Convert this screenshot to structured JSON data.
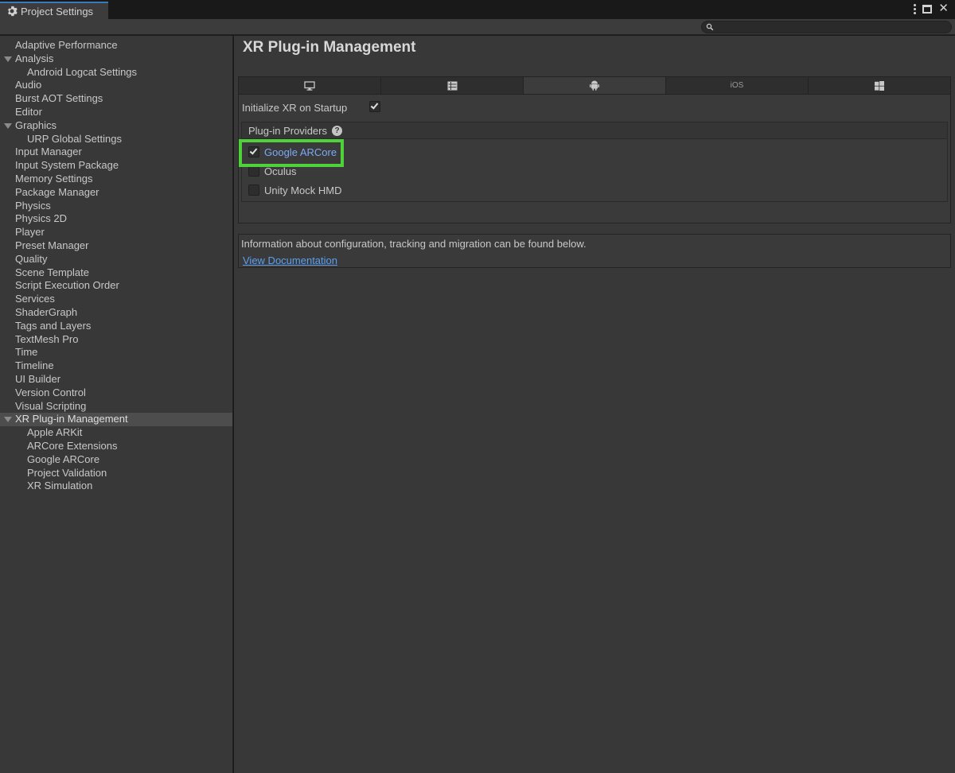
{
  "window": {
    "tab_title": "Project Settings"
  },
  "search": {
    "placeholder": ""
  },
  "sidebar": {
    "items": [
      {
        "label": "Adaptive Performance",
        "level": 0
      },
      {
        "label": "Analysis",
        "level": 0,
        "expanded": true
      },
      {
        "label": "Android Logcat Settings",
        "level": 1
      },
      {
        "label": "Audio",
        "level": 0
      },
      {
        "label": "Burst AOT Settings",
        "level": 0
      },
      {
        "label": "Editor",
        "level": 0
      },
      {
        "label": "Graphics",
        "level": 0,
        "expanded": true
      },
      {
        "label": "URP Global Settings",
        "level": 1
      },
      {
        "label": "Input Manager",
        "level": 0
      },
      {
        "label": "Input System Package",
        "level": 0
      },
      {
        "label": "Memory Settings",
        "level": 0
      },
      {
        "label": "Package Manager",
        "level": 0
      },
      {
        "label": "Physics",
        "level": 0
      },
      {
        "label": "Physics 2D",
        "level": 0
      },
      {
        "label": "Player",
        "level": 0
      },
      {
        "label": "Preset Manager",
        "level": 0
      },
      {
        "label": "Quality",
        "level": 0
      },
      {
        "label": "Scene Template",
        "level": 0
      },
      {
        "label": "Script Execution Order",
        "level": 0
      },
      {
        "label": "Services",
        "level": 0
      },
      {
        "label": "ShaderGraph",
        "level": 0
      },
      {
        "label": "Tags and Layers",
        "level": 0
      },
      {
        "label": "TextMesh Pro",
        "level": 0
      },
      {
        "label": "Time",
        "level": 0
      },
      {
        "label": "Timeline",
        "level": 0
      },
      {
        "label": "UI Builder",
        "level": 0
      },
      {
        "label": "Version Control",
        "level": 0
      },
      {
        "label": "Visual Scripting",
        "level": 0
      },
      {
        "label": "XR Plug-in Management",
        "level": 0,
        "expanded": true,
        "selected": true
      },
      {
        "label": "Apple ARKit",
        "level": 1
      },
      {
        "label": "ARCore Extensions",
        "level": 1
      },
      {
        "label": "Google ARCore",
        "level": 1
      },
      {
        "label": "Project Validation",
        "level": 1
      },
      {
        "label": "XR Simulation",
        "level": 1
      }
    ]
  },
  "main": {
    "title": "XR Plug-in Management",
    "platform_tabs": [
      {
        "icon": "desktop-icon",
        "label": "",
        "active": false
      },
      {
        "icon": "server-icon",
        "label": "",
        "active": false
      },
      {
        "icon": "android-icon",
        "label": "",
        "active": true
      },
      {
        "icon": "ios-label",
        "label": "iOS",
        "active": false
      },
      {
        "icon": "windows-icon",
        "label": "",
        "active": false
      }
    ],
    "init_xr_label": "Initialize XR on Startup",
    "init_xr_checked": true,
    "providers_header": "Plug-in Providers",
    "providers": [
      {
        "label": "Google ARCore",
        "checked": true
      },
      {
        "label": "Oculus",
        "checked": false
      },
      {
        "label": "Unity Mock HMD",
        "checked": false
      }
    ],
    "info_text": "Information about configuration, tracking and migration can be found below.",
    "doc_link": "View Documentation"
  },
  "colors": {
    "highlight": "#4fd13a",
    "link": "#5c9ff0",
    "selected_provider": "#7baaf7"
  }
}
